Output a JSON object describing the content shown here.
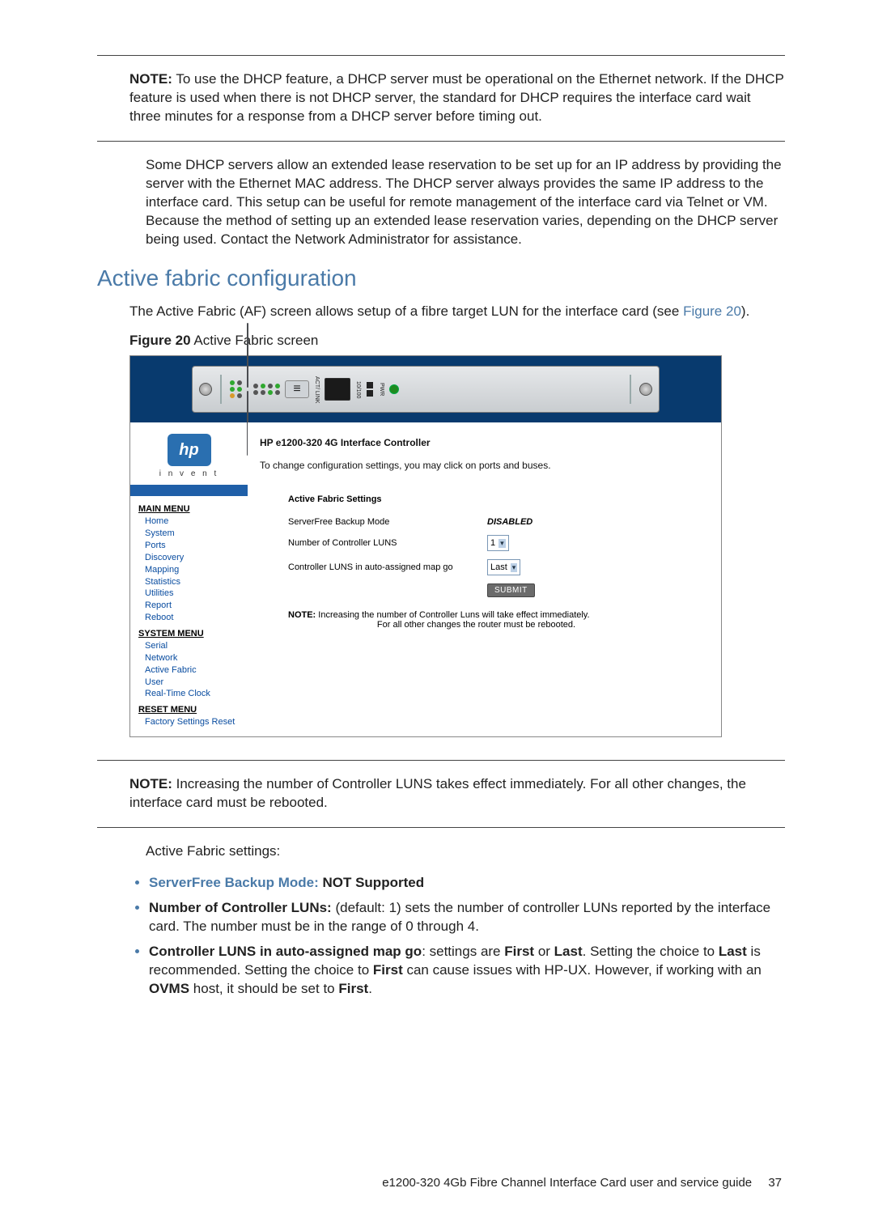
{
  "note1": {
    "lead": "NOTE:",
    "body": "To use the DHCP feature, a DHCP server must be operational on the Ethernet network. If the DHCP feature is used when there is not DHCP server, the standard for DHCP requires the interface card wait three minutes for a response from a DHCP server before timing out."
  },
  "para1": "Some DHCP servers allow an extended lease reservation to be set up for an IP address by providing the server with the Ethernet MAC address. The DHCP server always provides the same IP address to the interface card. This setup can be useful for remote management of the interface card via Telnet or VM. Because the method of setting up an extended lease reservation varies, depending on the DHCP server being used. Contact the Network Administrator for assistance.",
  "section_heading": "Active fabric configuration",
  "para2_a": "The Active Fabric (AF) screen allows setup of a fibre target LUN for the interface card (see ",
  "para2_link": "Figure 20",
  "para2_b": ").",
  "figcap_lead": "Figure 20",
  "figcap_text": "Active Fabric screen",
  "screenshot": {
    "header_title": "HP e1200-320 4G Interface Controller",
    "header_sub": "To change configuration settings, you may click on ports and buses.",
    "sidebar": {
      "main_head": "MAIN MENU",
      "main_items": [
        "Home",
        "System",
        "Ports",
        "Discovery",
        "Mapping",
        "Statistics",
        "Utilities",
        "Report",
        "Reboot"
      ],
      "sys_head": "SYSTEM MENU",
      "sys_items": [
        "Serial",
        "Network",
        "Active Fabric",
        "User",
        "Real-Time Clock"
      ],
      "reset_head": "RESET MENU",
      "reset_items": [
        "Factory Settings Reset"
      ]
    },
    "content": {
      "title": "Active Fabric Settings",
      "row1_label": "ServerFree Backup Mode",
      "row1_value": "DISABLED",
      "row2_label": "Number of Controller LUNS",
      "row2_value": "1",
      "row3_label": "Controller LUNS in auto-assigned map go",
      "row3_value": "Last",
      "submit": "SUBMIT",
      "note_lead": "NOTE:",
      "note_l1": "Increasing the number of Controller Luns will take effect immediately.",
      "note_l2": "For all other changes the router must be rebooted."
    },
    "invent": "i n v e n t"
  },
  "note2": {
    "lead": "NOTE:",
    "body": "Increasing the number of Controller LUNS takes effect immediately. For all other changes, the interface card must be rebooted."
  },
  "para3": "Active Fabric settings:",
  "bullets": {
    "b1_label": "ServerFree Backup Mode:",
    "b1_rest": " NOT Supported",
    "b2_label": "Number of Controller LUNs:",
    "b2_rest_a": " (default: 1) sets the number of controller LUNs reported by the interface card. The number must be in the range of 0 through 4.",
    "b3_label": "Controller LUNS in auto-assigned map go",
    "b3_rest_a": ": settings are ",
    "b3_first": "First",
    "b3_or": " or ",
    "b3_last": "Last",
    "b3_rest_b": ". Setting the choice to ",
    "b3_rest_c": " is recommended. Setting the choice to ",
    "b3_rest_d": " can cause issues with HP-UX. However, if working with an ",
    "b3_ovms": "OVMS",
    "b3_rest_e": " host, it should be set to ",
    "b3_rest_f": "."
  },
  "footer_text": "e1200-320 4Gb Fibre Channel Interface Card user and service guide",
  "footer_page": "37"
}
